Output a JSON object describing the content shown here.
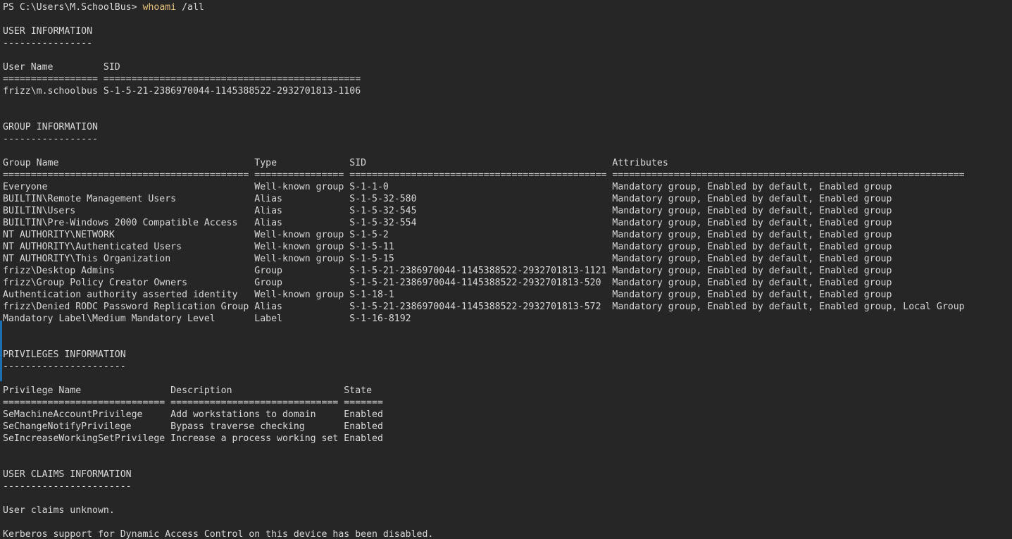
{
  "prompt": {
    "text": "PS C:\\Users\\M.SchoolBus> ",
    "command": "whoami",
    "args": " /all"
  },
  "user_info": {
    "heading": "USER INFORMATION",
    "underline": "----------------",
    "columns_line": "User Name         SID",
    "separator": "================= ==============================================",
    "row": "frizz\\m.schoolbus S-1-5-21-2386970044-1145388522-2932701813-1106"
  },
  "group_info": {
    "heading": "GROUP INFORMATION",
    "underline": "-----------------",
    "columns_line": "Group Name                                   Type             SID                                            Attributes",
    "separator": "============================================ ================ ============================================== ===============================================================",
    "rows": [
      "Everyone                                     Well-known group S-1-1-0                                        Mandatory group, Enabled by default, Enabled group",
      "BUILTIN\\Remote Management Users              Alias            S-1-5-32-580                                   Mandatory group, Enabled by default, Enabled group",
      "BUILTIN\\Users                                Alias            S-1-5-32-545                                   Mandatory group, Enabled by default, Enabled group",
      "BUILTIN\\Pre-Windows 2000 Compatible Access   Alias            S-1-5-32-554                                   Mandatory group, Enabled by default, Enabled group",
      "NT AUTHORITY\\NETWORK                         Well-known group S-1-5-2                                        Mandatory group, Enabled by default, Enabled group",
      "NT AUTHORITY\\Authenticated Users             Well-known group S-1-5-11                                       Mandatory group, Enabled by default, Enabled group",
      "NT AUTHORITY\\This Organization               Well-known group S-1-5-15                                       Mandatory group, Enabled by default, Enabled group",
      "frizz\\Desktop Admins                         Group            S-1-5-21-2386970044-1145388522-2932701813-1121 Mandatory group, Enabled by default, Enabled group",
      "frizz\\Group Policy Creator Owners            Group            S-1-5-21-2386970044-1145388522-2932701813-520  Mandatory group, Enabled by default, Enabled group",
      "Authentication authority asserted identity   Well-known group S-1-18-1                                       Mandatory group, Enabled by default, Enabled group",
      "frizz\\Denied RODC Password Replication Group Alias            S-1-5-21-2386970044-1145388522-2932701813-572  Mandatory group, Enabled by default, Enabled group, Local Group",
      "Mandatory Label\\Medium Mandatory Level       Label            S-1-16-8192"
    ]
  },
  "privileges_info": {
    "heading": "PRIVILEGES INFORMATION",
    "underline": "----------------------",
    "columns_line": "Privilege Name                Description                    State",
    "separator": "============================= ============================== =======",
    "rows": [
      "SeMachineAccountPrivilege     Add workstations to domain     Enabled",
      "SeChangeNotifyPrivilege       Bypass traverse checking       Enabled",
      "SeIncreaseWorkingSetPrivilege Increase a process working set Enabled"
    ]
  },
  "claims_info": {
    "heading": "USER CLAIMS INFORMATION",
    "underline": "-----------------------",
    "message": "User claims unknown.",
    "kerberos": "Kerberos support for Dynamic Access Control on this device has been disabled."
  }
}
